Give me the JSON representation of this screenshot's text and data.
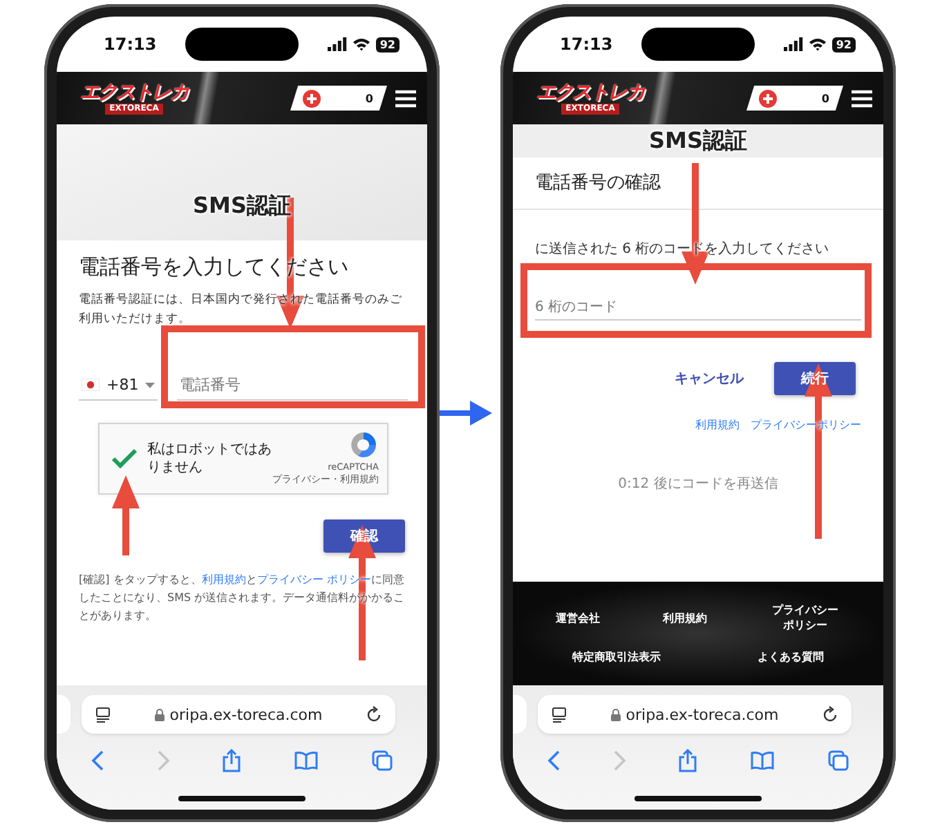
{
  "screens": [
    {
      "kind": "phone-entry",
      "status": {
        "time": "17:13",
        "battery": "92"
      },
      "header": {
        "logo": "エクストレカ",
        "logo_sub": "EXTORECA",
        "points": "0"
      },
      "page_title": "SMS認証",
      "heading": "電話番号を入力してください",
      "note": "電話番号認証には、日本国内で発行された電話番号のみご利用いただけます。",
      "country_code": "+81",
      "phone_field": {
        "placeholder": "電話番号"
      },
      "captcha": {
        "label": "私はロボットではありません",
        "checked": true,
        "brand": "reCAPTCHA",
        "links": "プライバシー・利用規約"
      },
      "confirm_button": "確認",
      "legal": [
        {
          "text": "[確認] をタップすると、",
          "link": false
        },
        {
          "text": "利用規約",
          "link": true
        },
        {
          "text": "と",
          "link": false
        },
        {
          "text": "プライバシー ポリシー",
          "link": true
        },
        {
          "text": "に同意したことになり、SMS が送信されます。データ通信料がかかることがあります。",
          "link": false
        }
      ],
      "browser": {
        "url": "oripa.ex-toreca.com"
      }
    },
    {
      "kind": "code-entry",
      "status": {
        "time": "17:13",
        "battery": "92"
      },
      "header": {
        "logo": "エクストレカ",
        "logo_sub": "EXTORECA",
        "points": "0"
      },
      "page_title": "SMS認証",
      "heading": "電話番号の確認",
      "instruction": "に送信された 6 桁のコードを入力してください",
      "code_field": {
        "placeholder": "6 桁のコード"
      },
      "cancel_button": "キャンセル",
      "continue_button": "続行",
      "links": [
        "利用規約",
        "プライバシーポリシー"
      ],
      "resend": "0:12 後にコードを再送信",
      "footer": [
        [
          "運営会社",
          "利用規約",
          "プライバシーポリシー"
        ],
        [
          "特定商取引法表示",
          "よくある質問"
        ]
      ],
      "browser": {
        "url": "oripa.ex-toreca.com"
      }
    }
  ]
}
